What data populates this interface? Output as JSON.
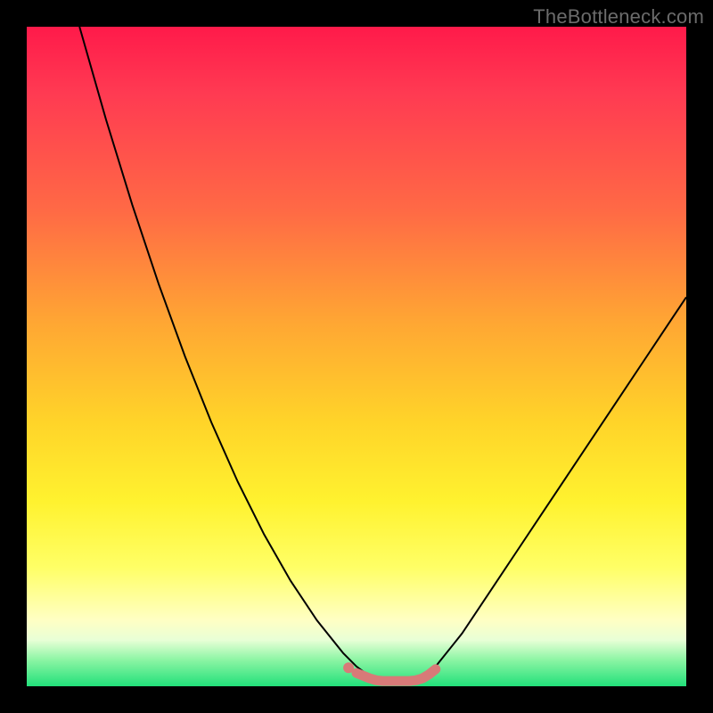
{
  "watermark": "TheBottleneck.com",
  "gradient_colors": {
    "top": "#ff1a4a",
    "mid_orange": "#ffa733",
    "mid_yellow": "#fff22f",
    "pale": "#ffffc4",
    "bottom": "#22e07a"
  },
  "chart_data": {
    "type": "line",
    "title": "",
    "xlabel": "",
    "ylabel": "",
    "xlim": [
      0,
      100
    ],
    "ylim": [
      0,
      100
    ],
    "curve": {
      "name": "bottleneck-curve",
      "color": "#000000",
      "points": [
        {
          "x": 8,
          "y": 100
        },
        {
          "x": 12,
          "y": 86
        },
        {
          "x": 16,
          "y": 73
        },
        {
          "x": 20,
          "y": 61
        },
        {
          "x": 24,
          "y": 50
        },
        {
          "x": 28,
          "y": 40
        },
        {
          "x": 32,
          "y": 31
        },
        {
          "x": 36,
          "y": 23
        },
        {
          "x": 40,
          "y": 16
        },
        {
          "x": 44,
          "y": 10
        },
        {
          "x": 48,
          "y": 5
        },
        {
          "x": 50,
          "y": 3
        },
        {
          "x": 52,
          "y": 1.5
        },
        {
          "x": 54,
          "y": 1
        },
        {
          "x": 56,
          "y": 1
        },
        {
          "x": 58,
          "y": 1
        },
        {
          "x": 60,
          "y": 1.5
        },
        {
          "x": 62,
          "y": 3
        },
        {
          "x": 66,
          "y": 8
        },
        {
          "x": 70,
          "y": 14
        },
        {
          "x": 74,
          "y": 20
        },
        {
          "x": 78,
          "y": 26
        },
        {
          "x": 82,
          "y": 32
        },
        {
          "x": 86,
          "y": 38
        },
        {
          "x": 90,
          "y": 44
        },
        {
          "x": 94,
          "y": 50
        },
        {
          "x": 98,
          "y": 56
        },
        {
          "x": 100,
          "y": 59
        }
      ]
    },
    "marker_band": {
      "name": "optimal-range-markers",
      "color": "#d87a78",
      "points": [
        {
          "x": 50,
          "y": 2.0
        },
        {
          "x": 52,
          "y": 1.2
        },
        {
          "x": 53,
          "y": 0.9
        },
        {
          "x": 54,
          "y": 0.8
        },
        {
          "x": 55,
          "y": 0.8
        },
        {
          "x": 56,
          "y": 0.8
        },
        {
          "x": 57,
          "y": 0.8
        },
        {
          "x": 58,
          "y": 0.8
        },
        {
          "x": 59,
          "y": 0.9
        },
        {
          "x": 60,
          "y": 1.2
        },
        {
          "x": 61,
          "y": 1.8
        },
        {
          "x": 62,
          "y": 2.6
        }
      ]
    }
  }
}
